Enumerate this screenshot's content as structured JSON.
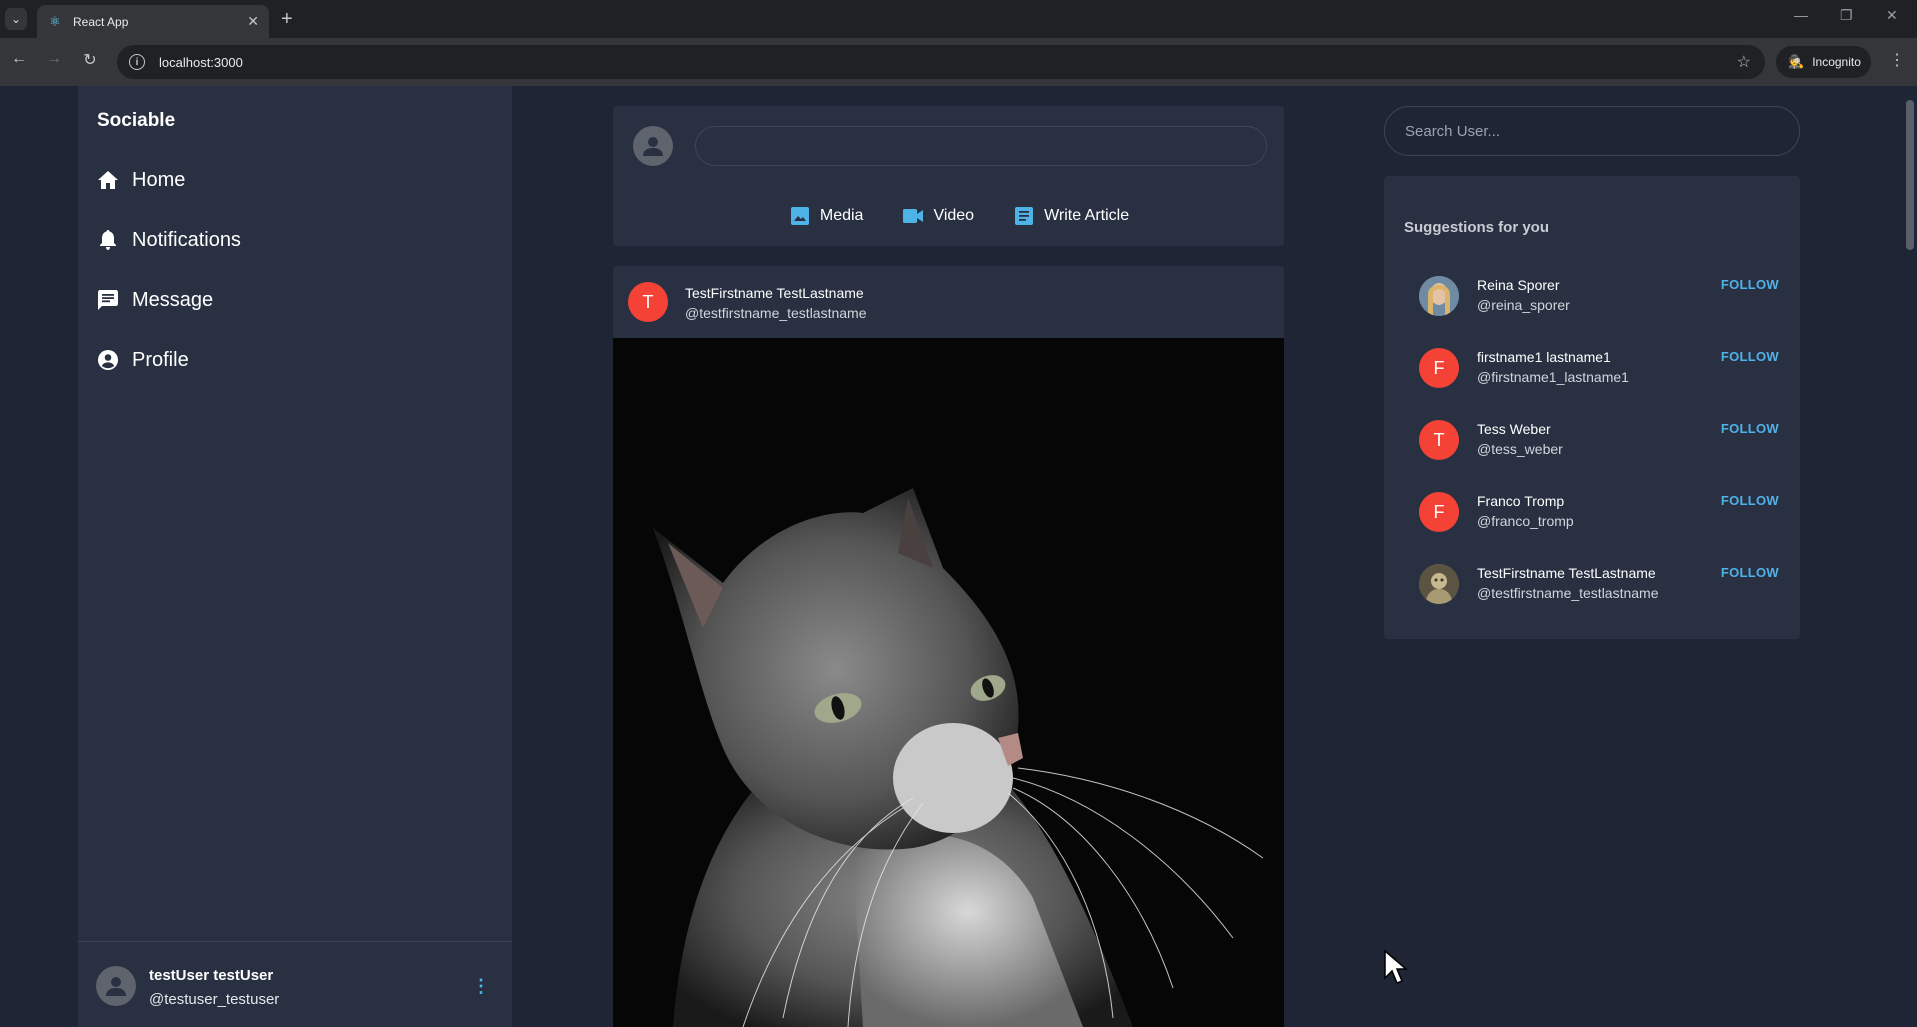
{
  "browser": {
    "tab_title": "React App",
    "url": "localhost:3000",
    "incognito_label": "Incognito"
  },
  "sidebar": {
    "brand": "Sociable",
    "items": [
      {
        "label": "Home",
        "icon": "home-icon"
      },
      {
        "label": "Notifications",
        "icon": "bell-icon"
      },
      {
        "label": "Message",
        "icon": "message-icon"
      },
      {
        "label": "Profile",
        "icon": "account-circle-icon"
      }
    ],
    "user": {
      "name": "testUser testUser",
      "handle": "@testuser_testuser"
    }
  },
  "composer": {
    "actions": [
      {
        "label": "Media",
        "icon": "image-icon"
      },
      {
        "label": "Video",
        "icon": "videocam-icon"
      },
      {
        "label": "Write Article",
        "icon": "article-icon"
      }
    ]
  },
  "post": {
    "avatar_letter": "T",
    "author_name": "TestFirstname TestLastname",
    "author_handle": "@testfirstname_testlastname"
  },
  "search": {
    "placeholder": "Search User..."
  },
  "suggestions": {
    "title": "Suggestions for you",
    "follow_label": "FOLLOW",
    "users": [
      {
        "name": "Reina Sporer",
        "handle": "@reina_sporer",
        "avatar": "photo"
      },
      {
        "name": "firstname1 lastname1",
        "handle": "@firstname1_lastname1",
        "avatar": "F"
      },
      {
        "name": "Tess Weber",
        "handle": "@tess_weber",
        "avatar": "T"
      },
      {
        "name": "Franco Tromp",
        "handle": "@franco_tromp",
        "avatar": "F"
      },
      {
        "name": "TestFirstname TestLastname",
        "handle": "@testfirstname_testlastname",
        "avatar": "photo"
      }
    ]
  },
  "colors": {
    "page_bg": "#1f2535",
    "panel_bg": "#283042",
    "accent": "#4fb3e8",
    "avatar_red": "#f44336"
  }
}
